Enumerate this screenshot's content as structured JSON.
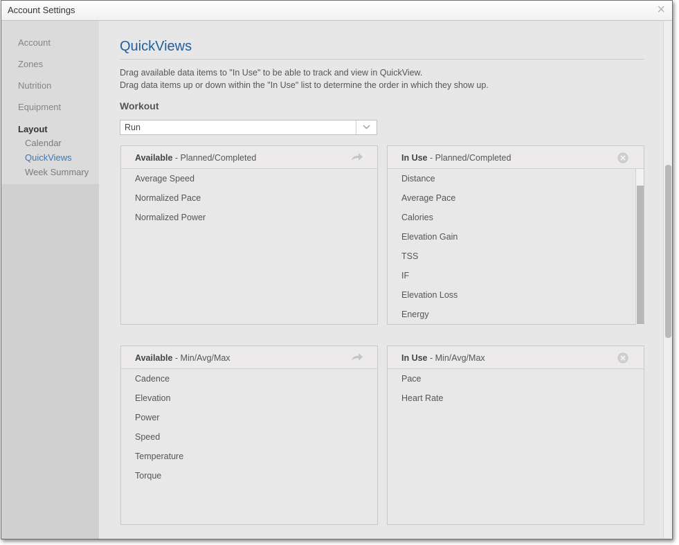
{
  "window": {
    "title": "Account Settings",
    "close_glyph": "×"
  },
  "sidebar": {
    "items": [
      {
        "label": "Account"
      },
      {
        "label": "Zones"
      },
      {
        "label": "Nutrition"
      },
      {
        "label": "Equipment"
      }
    ],
    "section": "Layout",
    "sub_items": [
      {
        "label": "Calendar"
      },
      {
        "label": "QuickViews",
        "active": true
      },
      {
        "label": "Week Summary"
      }
    ]
  },
  "main": {
    "title": "QuickViews",
    "description_lines": [
      "Drag available data items to \"In Use\" to be able to track and view in QuickView.",
      "Drag data items up or down within the \"In Use\" list to determine the order in which they show up."
    ],
    "workout_label": "Workout",
    "workout_select": {
      "value": "Run"
    },
    "panels": {
      "available_planned": {
        "title_bold": "Available",
        "title_rest": " - Planned/Completed",
        "icon": "arrow-right-icon",
        "items": [
          "Average Speed",
          "Normalized Pace",
          "Normalized Power"
        ]
      },
      "inuse_planned": {
        "title_bold": "In Use",
        "title_rest": " - Planned/Completed",
        "icon": "clear-circle-x-icon",
        "items": [
          "Distance",
          "Average Pace",
          "Calories",
          "Elevation Gain",
          "TSS",
          "IF",
          "Elevation Loss",
          "Energy"
        ]
      },
      "available_minmax": {
        "title_bold": "Available",
        "title_rest": " - Min/Avg/Max",
        "icon": "arrow-right-icon",
        "items": [
          "Cadence",
          "Elevation",
          "Power",
          "Speed",
          "Temperature",
          "Torque"
        ]
      },
      "inuse_minmax": {
        "title_bold": "In Use",
        "title_rest": " - Min/Avg/Max",
        "icon": "clear-circle-x-icon",
        "items": [
          "Pace",
          "Heart Rate"
        ]
      }
    }
  },
  "colors": {
    "accent": "#1f5e9c",
    "link_active": "#3b78b8",
    "sidebar_bg": "#d1d0d0",
    "content_bg": "#e8e7e7"
  }
}
